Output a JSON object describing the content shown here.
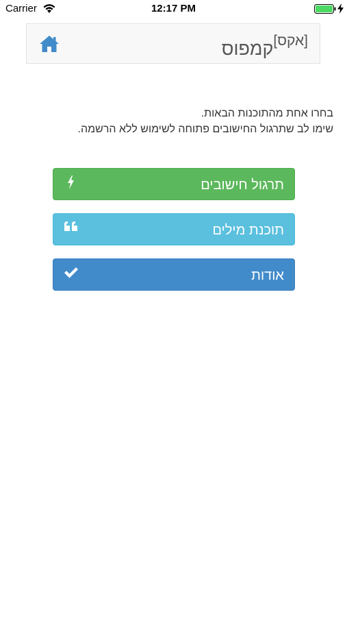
{
  "status_bar": {
    "carrier": "Carrier",
    "time": "12:17 PM"
  },
  "navbar": {
    "brand_sup": "[אקס]",
    "brand_main": "קמפוס",
    "home_icon": "home-icon",
    "accent_color": "#428bca"
  },
  "intro": {
    "line1": "בחרו אחת מהתוכנות הבאות.",
    "line2": "שימו לב שתרגול החישובים פתוחה לשימוש ללא הרשמה."
  },
  "menu": {
    "items": [
      {
        "label": "תרגול חישובים",
        "icon": "bolt-icon",
        "color": "#5cb85c"
      },
      {
        "label": "תוכנת מילים",
        "icon": "quote-icon",
        "color": "#5bc0de"
      },
      {
        "label": "אודות",
        "icon": "check-icon",
        "color": "#428bca"
      }
    ]
  }
}
